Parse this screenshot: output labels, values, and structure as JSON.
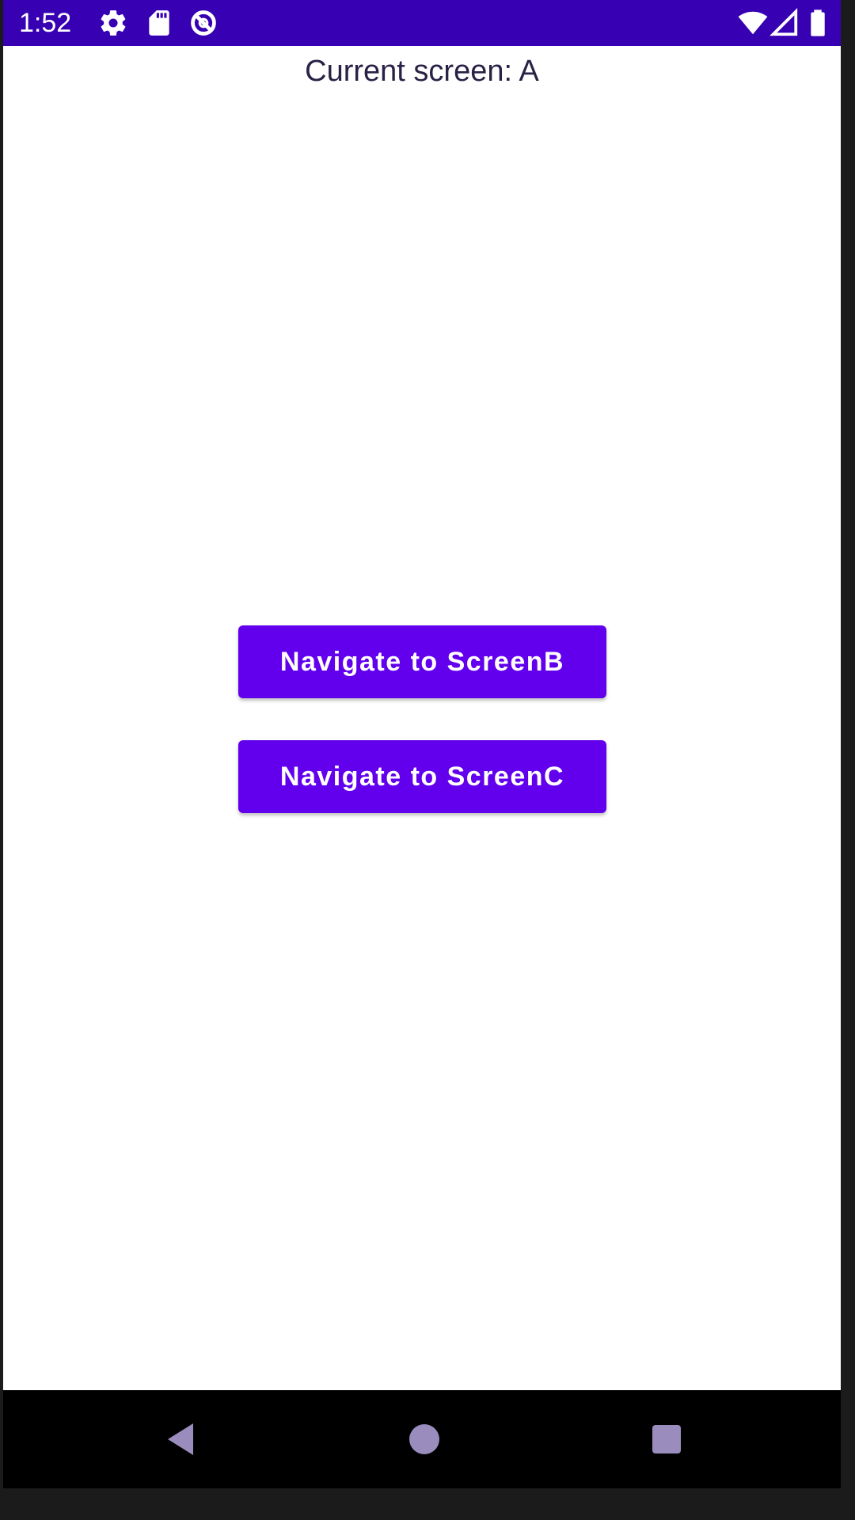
{
  "status_bar": {
    "time": "1:52",
    "background_color": "#3700b3",
    "icons_left": [
      "settings-icon",
      "sd-card-icon",
      "data-saver-icon"
    ],
    "icons_right": [
      "wifi-icon",
      "signal-icon",
      "battery-icon"
    ]
  },
  "main": {
    "title": "Current screen: A",
    "buttons": [
      {
        "label": "Navigate to ScreenB",
        "color": "#6200ee"
      },
      {
        "label": "Navigate to ScreenC",
        "color": "#6200ee"
      }
    ]
  },
  "nav_bar": {
    "keys": [
      "back-icon",
      "home-icon",
      "recents-icon"
    ],
    "key_color": "#9a8dbd"
  }
}
